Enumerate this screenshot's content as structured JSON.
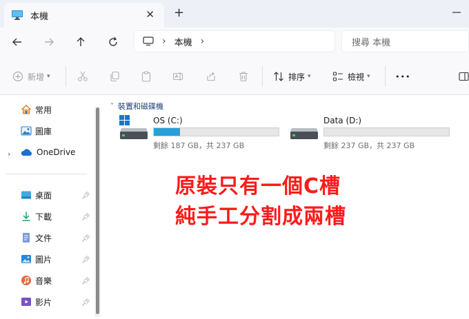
{
  "tab": {
    "title": "本機",
    "close_glyph": "✕",
    "new_tab_glyph": "+"
  },
  "address": {
    "segment": "本機",
    "separator": "›"
  },
  "search": {
    "placeholder": "搜尋 本機"
  },
  "toolbar": {
    "new_label": "新增",
    "sort_label": "排序",
    "view_label": "檢視",
    "more_glyph": "•••"
  },
  "sidebar": {
    "items": [
      {
        "label": "常用",
        "icon": "home-icon"
      },
      {
        "label": "圖庫",
        "icon": "gallery-icon"
      },
      {
        "label": "OneDrive",
        "icon": "onedrive-cloud-icon",
        "expandable": true
      }
    ],
    "quick_access": [
      {
        "label": "桌面",
        "icon": "desktop-icon",
        "pinned": true
      },
      {
        "label": "下載",
        "icon": "download-icon",
        "pinned": true
      },
      {
        "label": "文件",
        "icon": "documents-icon",
        "pinned": true
      },
      {
        "label": "圖片",
        "icon": "pictures-icon",
        "pinned": true
      },
      {
        "label": "音樂",
        "icon": "music-icon",
        "pinned": true
      },
      {
        "label": "影片",
        "icon": "videos-icon",
        "pinned": true
      }
    ]
  },
  "section": {
    "title": "裝置和磁碟機"
  },
  "drives": [
    {
      "name": "OS (C:)",
      "info": "剩餘 187 GB，共 237 GB",
      "used_fraction": 0.21
    },
    {
      "name": "Data (D:)",
      "info": "剩餘 237 GB，共 237 GB",
      "used_fraction": 0.0
    }
  ],
  "annotations": {
    "line1": "原裝只有一個C槽",
    "line2": "純手工分割成兩槽"
  },
  "colors": {
    "accent": "#26a0da",
    "annotation": "#ff1a1a"
  }
}
